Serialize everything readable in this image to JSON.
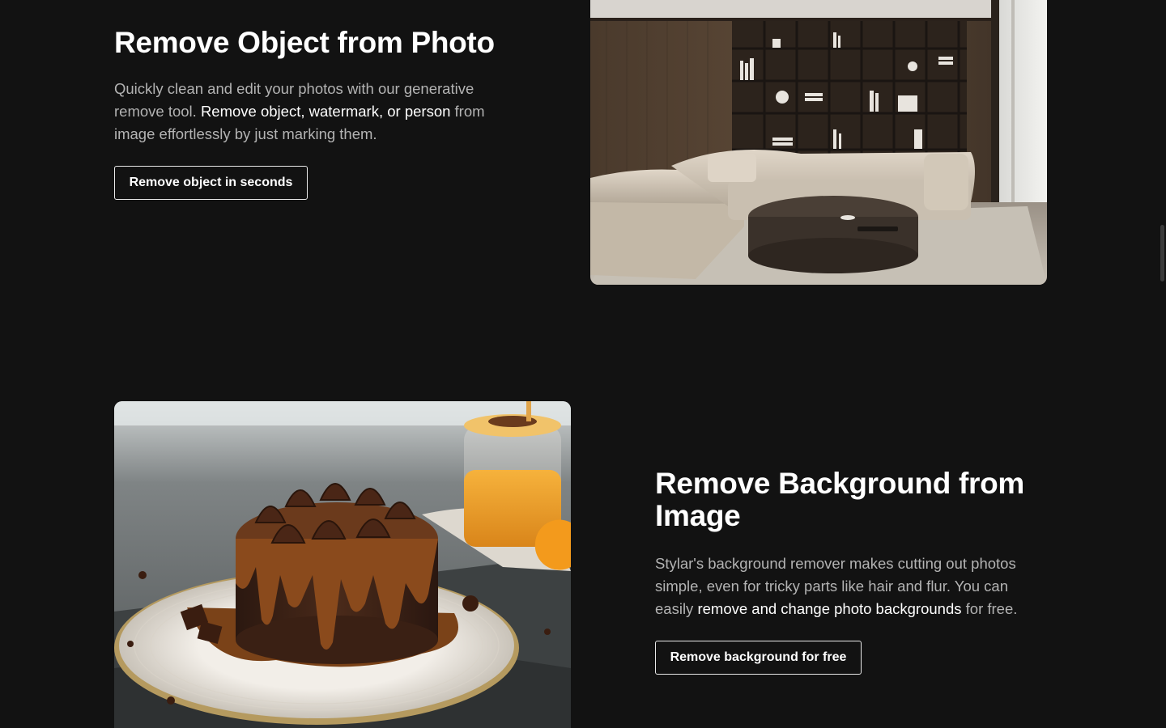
{
  "object_section": {
    "title": "Remove Object from Photo",
    "desc_part1": "Quickly clean and edit your photos with our generative remove tool. ",
    "desc_highlight": "Remove object, watermark, or person",
    "desc_part2": " from image effortlessly by just marking them.",
    "cta_label": "Remove object in seconds"
  },
  "background_section": {
    "title": "Remove Background from Image",
    "desc_part1": "Stylar's background remover makes cutting out photos simple, even for tricky parts like hair and flur. You can easily ",
    "desc_highlight": "remove and change photo backgrounds",
    "desc_part2": " for free.",
    "cta_label": "Remove background for free"
  },
  "colors": {
    "page_bg": "#121212",
    "text_primary": "#ffffff",
    "text_secondary": "#b3b3b3",
    "button_border": "#e9e9e9"
  }
}
